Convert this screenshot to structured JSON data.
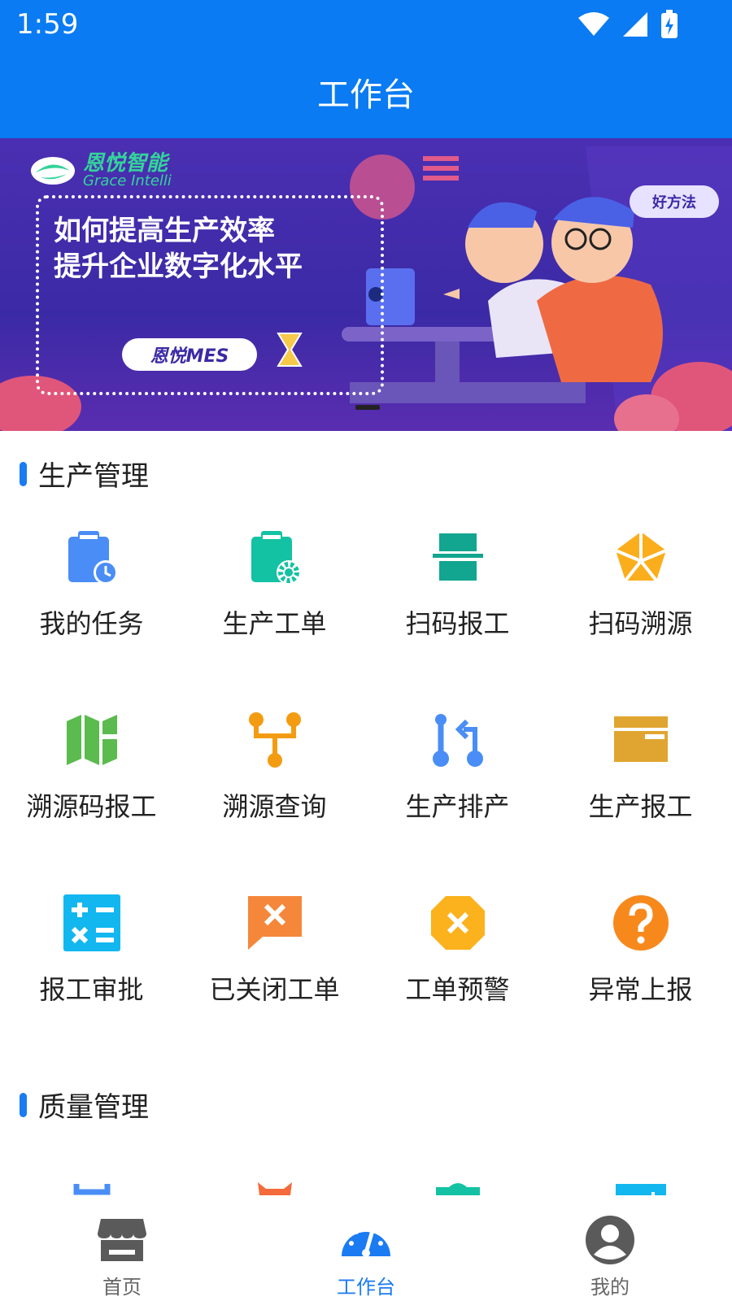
{
  "status_bar": {
    "time": "1:59"
  },
  "header": {
    "title": "工作台"
  },
  "banner": {
    "brand_name": "恩悦智能",
    "brand_english": "Grace Intelli",
    "headline_line1": "如何提高生产效率",
    "headline_line2": "提升企业数字化水平",
    "pill_text": "恩悦MES",
    "bubble_text": "好方法"
  },
  "sections": [
    {
      "title": "生产管理",
      "items": [
        {
          "label": "我的任务",
          "icon": "clipboard-clock-icon",
          "color": "#4a8df6"
        },
        {
          "label": "生产工单",
          "icon": "clipboard-gear-icon",
          "color": "#13c2a3"
        },
        {
          "label": "扫码报工",
          "icon": "scan-lines-icon",
          "color": "#12a58f"
        },
        {
          "label": "扫码溯源",
          "icon": "pentagon-star-icon",
          "color": "#fbae1c"
        },
        {
          "label": "溯源码报工",
          "icon": "map-icon",
          "color": "#5bbb4e"
        },
        {
          "label": "溯源查询",
          "icon": "branch-icon",
          "color": "#f39c12"
        },
        {
          "label": "生产排产",
          "icon": "pull-request-icon",
          "color": "#4a8df6"
        },
        {
          "label": "生产报工",
          "icon": "card-icon",
          "color": "#e0a530"
        },
        {
          "label": "报工审批",
          "icon": "calculator-icon",
          "color": "#12b7f0"
        },
        {
          "label": "已关闭工单",
          "icon": "chat-close-icon",
          "color": "#f5873b"
        },
        {
          "label": "工单预警",
          "icon": "octagon-close-icon",
          "color": "#fbb21c"
        },
        {
          "label": "异常上报",
          "icon": "question-icon",
          "color": "#f7891c"
        }
      ]
    },
    {
      "title": "质量管理",
      "peek_colors": [
        "#4a8df6",
        "#f56a3b",
        "#13c2a3",
        "#12b7f0"
      ]
    }
  ],
  "tabbar": [
    {
      "label": "首页",
      "icon": "store-icon",
      "active": false
    },
    {
      "label": "工作台",
      "icon": "dashboard-icon",
      "active": true
    },
    {
      "label": "我的",
      "icon": "user-icon",
      "active": false
    }
  ]
}
